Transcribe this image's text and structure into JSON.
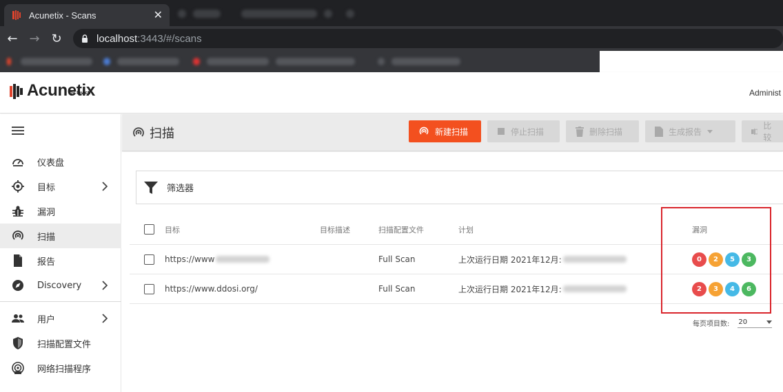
{
  "browser": {
    "tab_title": "Acunetix - Scans",
    "url_host": "localhost",
    "url_rest": ":3443/#/scans"
  },
  "app": {
    "brand": "Acunetix",
    "brand_by": "by Invicti",
    "user": "Administ"
  },
  "sidebar": {
    "items": [
      {
        "label": "仪表盘",
        "icon": "dashboard-gauge-icon",
        "chevron": false
      },
      {
        "label": "目标",
        "icon": "target-crosshair-icon",
        "chevron": true
      },
      {
        "label": "漏洞",
        "icon": "bug-icon",
        "chevron": false
      },
      {
        "label": "扫描",
        "icon": "radar-scan-icon",
        "chevron": false,
        "active": true
      },
      {
        "label": "报告",
        "icon": "document-icon",
        "chevron": false
      },
      {
        "label": "Discovery",
        "icon": "compass-icon",
        "chevron": true
      },
      {
        "label": "用户",
        "icon": "users-icon",
        "chevron": true
      },
      {
        "label": "扫描配置文件",
        "icon": "shield-icon",
        "chevron": false
      },
      {
        "label": "网络扫描程序",
        "icon": "network-scanner-icon",
        "chevron": false
      }
    ]
  },
  "toolbar": {
    "title": "扫描",
    "new_scan": "新建扫描",
    "stop_scan": "停止扫描",
    "delete_scan": "删除扫描",
    "generate_report": "生成报告",
    "compare": "比较"
  },
  "filter": {
    "label": "筛选器"
  },
  "table": {
    "headers": {
      "target": "目标",
      "description": "目标描述",
      "profile": "扫描配置文件",
      "schedule": "计划",
      "vulns": "漏洞"
    },
    "rows": [
      {
        "target": "https://www",
        "profile": "Full Scan",
        "schedule": "上次运行日期 2021年12月:",
        "vulns": [
          0,
          2,
          5,
          3
        ]
      },
      {
        "target": "https://www.ddosi.org/",
        "profile": "Full Scan",
        "schedule": "上次运行日期 2021年12月:",
        "vulns": [
          2,
          3,
          4,
          6
        ]
      }
    ]
  },
  "pagination": {
    "label": "每页项目数:",
    "value": "20"
  },
  "colors": {
    "accent": "#f3501f",
    "severity_high": "#e84c4c",
    "severity_medium": "#f6a234",
    "severity_low": "#45b9e6",
    "severity_info": "#4cb860",
    "annotation_box": "#d9232a"
  }
}
